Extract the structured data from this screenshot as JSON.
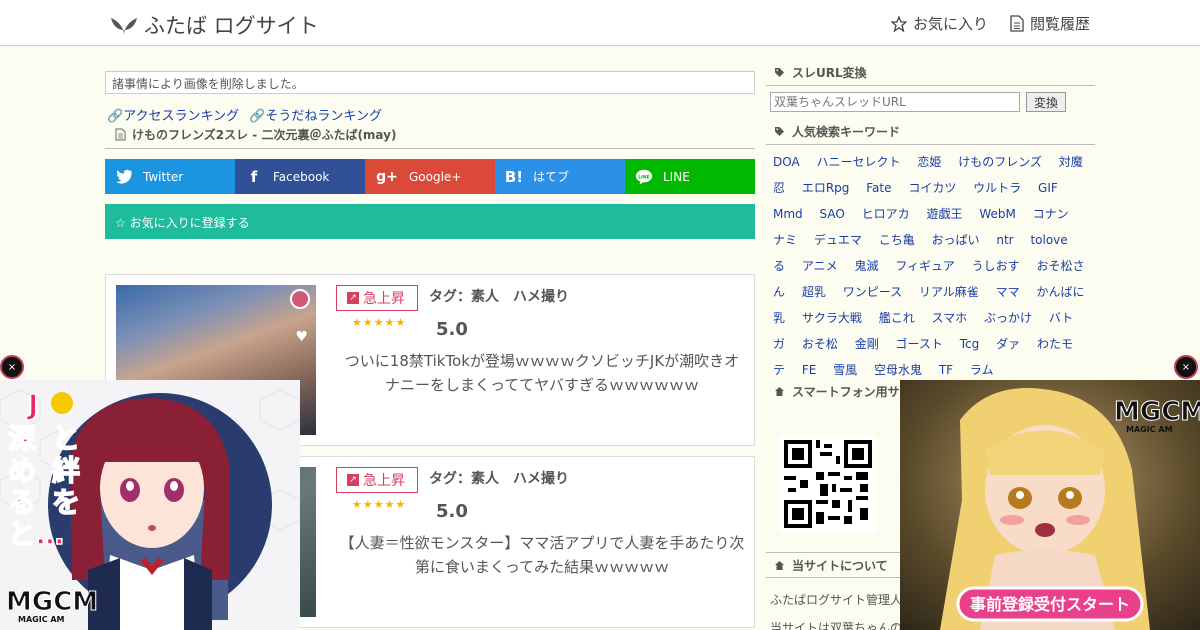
{
  "header": {
    "site_title": "ふたば ログサイト",
    "nav": [
      {
        "label": "お気に入り",
        "icon": "star-outline-icon"
      },
      {
        "label": "閲覧履歴",
        "icon": "document-icon"
      }
    ]
  },
  "notice": "諸事情により画像を削除しました。",
  "ranking_links": [
    "アクセスランキング",
    "そうだねランキング"
  ],
  "breadcrumb": "けものフレンズ2スレ - 二次元裏＠ふたば(may)",
  "share_buttons": [
    {
      "label": "Twitter",
      "color": "#1b95e0",
      "icon": "twitter-bird-icon"
    },
    {
      "label": "Facebook",
      "color": "#305097",
      "icon": "facebook-icon"
    },
    {
      "label": "Google+",
      "color": "#db4a39",
      "icon": "google-plus-icon"
    },
    {
      "label": "はてブ",
      "color": "#2c91e6",
      "icon": "hatena-bookmark-icon"
    },
    {
      "label": "LINE",
      "color": "#00b900",
      "icon": "line-icon"
    }
  ],
  "favorite_bar": {
    "label": "☆ お気に入りに登録する",
    "color": "#1fbc9c"
  },
  "articles": [
    {
      "badge": "急上昇",
      "tags": "タグ：素人　ハメ撮り",
      "rating": "5.0",
      "stars": 5,
      "title": "ついに18禁TikTokが登場ｗｗｗｗクソビッチJKが潮吹きオナニーをしまくっててヤバすぎるｗｗｗｗｗｗ"
    },
    {
      "badge": "急上昇",
      "tags": "タグ：素人　ハメ撮り",
      "rating": "5.0",
      "stars": 5,
      "title": "【人妻＝性欲モンスター】ママ活アプリで人妻を手あたり次第に食いまくってみた結果ｗｗｗｗｗ"
    }
  ],
  "sidebar": {
    "url_section": {
      "heading": "スレURL変換",
      "placeholder": "双葉ちゃんスレッドURL",
      "button": "変換"
    },
    "keywords_heading": "人気検索キーワード",
    "keywords": [
      "DOA",
      "ハニーセレクト",
      "恋姫",
      "けものフレンズ",
      "対魔忍",
      "エロRpg",
      "Fate",
      "コイカツ",
      "ウルトラ",
      "GIF",
      "Mmd",
      "SAO",
      "ヒロアカ",
      "遊戯王",
      "WebM",
      "コナン",
      "ナミ",
      "デュエマ",
      "こち亀",
      "おっぱい",
      "ntr",
      "tolove る",
      "アニメ",
      "鬼滅",
      "フィギュア",
      "うしおす",
      "おそ松さん",
      "超乳",
      "ワンピース",
      "リアル麻雀",
      "ママ",
      "かんばに乳",
      "サクラ大戦",
      "艦これ",
      "スマホ",
      "ぶっかけ",
      "バトガ",
      "おそ松",
      "金剛",
      "ゴースト",
      "Tcg",
      "ダァ",
      "わたモテ",
      "FE",
      "雪風",
      "空母水鬼",
      "TF",
      "ラム"
    ],
    "smartphone_heading": "スマートフォン用サ",
    "about_heading": "当サイトについて",
    "about_lines": [
      "ふたばログサイト管理人",
      "当サイトは双葉ちゃんの"
    ]
  },
  "ads": {
    "left": {
      "text": "Jと絆を深めると…",
      "brand": "MGCM",
      "brand_sub": "MAGIC AM"
    },
    "right": {
      "brand": "MGCM",
      "brand_sub": "MAGIC AM",
      "cta": "事前登録受付スタート"
    },
    "close_label": "×"
  }
}
